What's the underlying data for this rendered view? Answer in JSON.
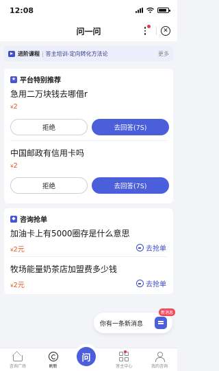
{
  "status_bar": {
    "time": "12:08"
  },
  "nav": {
    "title": "问一问"
  },
  "course_banner": {
    "tag": "进阶课程",
    "divider": "|",
    "description": "答主培训-定向转化方法论",
    "more": "更多"
  },
  "platform_recommend": {
    "heading": "平台特别推荐",
    "questions": [
      {
        "title": "急用二万块钱去哪借r",
        "currency": "¥",
        "price": "2",
        "reject_label": "拒绝",
        "answer_label": "去回答(7S)"
      },
      {
        "title": "中国邮政有信用卡吗",
        "currency": "¥",
        "price": "2",
        "reject_label": "拒绝",
        "answer_label": "去回答(7S)"
      }
    ]
  },
  "consult_grab": {
    "heading": "咨询抢单",
    "orders": [
      {
        "title": "加油卡上有5000圈存是什么意思",
        "currency": "¥",
        "price": "2元",
        "grab_label": "去抢单"
      },
      {
        "title": "牧场能量奶茶店加盟费多少钱",
        "currency": "¥",
        "price": "2元",
        "grab_label": "去抢单"
      }
    ]
  },
  "floating_message": {
    "text": "你有一条新消息",
    "badge": "新消息"
  },
  "tab_bar": {
    "tabs": [
      {
        "label": "咨询广场"
      },
      {
        "label": "刷新"
      },
      {
        "label": "问"
      },
      {
        "label": "答主中心"
      },
      {
        "label": "我的咨询"
      }
    ]
  },
  "colors": {
    "accent": "#4a5fd9",
    "price": "#e25b2c",
    "badge": "#f04a5e"
  },
  "icons": [
    "signal-icon",
    "wifi-icon",
    "battery-icon",
    "more-icon",
    "close-icon",
    "play-icon",
    "star-icon",
    "grab-icon",
    "message-icon",
    "home-icon",
    "refresh-icon",
    "grid-icon",
    "user-icon"
  ]
}
